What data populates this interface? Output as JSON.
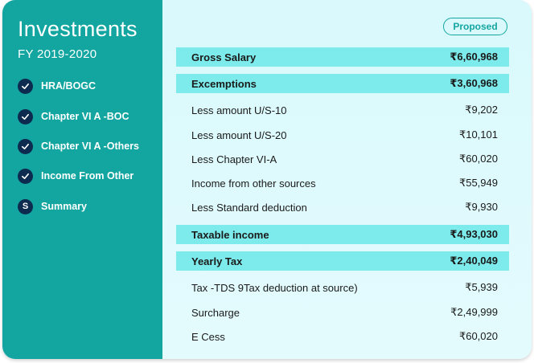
{
  "sidebar": {
    "title": "Investments",
    "subtitle": "FY 2019-2020",
    "items": [
      {
        "label": "HRA/BOGC",
        "badge": "check"
      },
      {
        "label": "Chapter VI A -BOC",
        "badge": "check"
      },
      {
        "label": "Chapter VI A -Others",
        "badge": "check"
      },
      {
        "label": "Income From Other",
        "badge": "check"
      },
      {
        "label": "Summary",
        "badge": "S"
      }
    ]
  },
  "main": {
    "status_label": "Proposed",
    "rows": [
      {
        "label": "Gross Salary",
        "value": "₹6,60,968",
        "highlight": true
      },
      {
        "label": "Excemptions",
        "value": "₹3,60,968",
        "highlight": true
      },
      {
        "label": "Less amount U/S-10",
        "value": "₹9,202",
        "highlight": false
      },
      {
        "label": "Less amount U/S-20",
        "value": "₹10,101",
        "highlight": false
      },
      {
        "label": "Less Chapter VI-A",
        "value": "₹60,020",
        "highlight": false
      },
      {
        "label": "Income from other sources",
        "value": "₹55,949",
        "highlight": false
      },
      {
        "label": "Less Standard deduction",
        "value": "₹9,930",
        "highlight": false
      },
      {
        "label": "Taxable income",
        "value": "₹4,93,030",
        "highlight": true
      },
      {
        "label": "Yearly Tax",
        "value": "₹2,40,049",
        "highlight": true
      },
      {
        "label": "Tax -TDS 9Tax deduction at source)",
        "value": "₹5,939",
        "highlight": false
      },
      {
        "label": "Surcharge",
        "value": "₹2,49,999",
        "highlight": false
      },
      {
        "label": "E Cess",
        "value": "₹60,020",
        "highlight": false
      }
    ]
  },
  "colors": {
    "sidebar_bg": "#13a6a1",
    "badge_bg": "#0d2b4f",
    "highlight_row": "#7debec",
    "main_bg": "#dffafd"
  }
}
